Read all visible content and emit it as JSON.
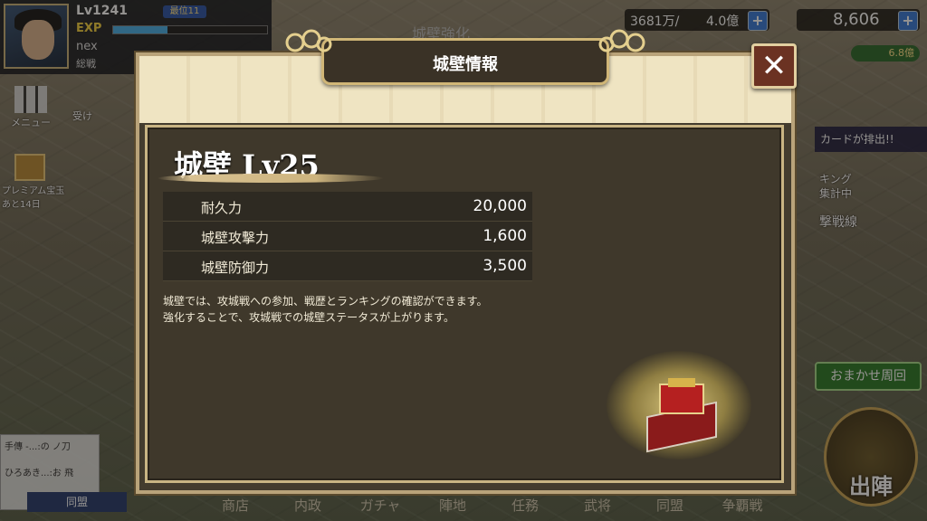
{
  "background": {
    "player": {
      "level": "Lv1241",
      "rank_badge": "最位11",
      "exp_label": "EXP",
      "exp_fill_pct": 35,
      "name": "nex",
      "power_label": "総戦"
    },
    "resource_1": {
      "value": "3681万/",
      "max": "4.0億"
    },
    "resource_2": {
      "value": "8,606"
    },
    "resource_sub": "6.8億",
    "background_title": "城壁強化",
    "menu_label": "メニュー",
    "receive_label": "受け",
    "premium_label": "プレミアム宝玉",
    "premium_days": "あと14日",
    "right_promo": "カードが排出!!",
    "right_ranking_1": "キング",
    "right_ranking_2": "集計中",
    "right_event": "撃戦線",
    "omakase_button": "おまかせ周回",
    "deploy_button": "出陣",
    "chat_lines": [
      "手傳 -...:の ノ刀",
      "ひろあき...:お 飛"
    ],
    "alliance_button": "同盟",
    "bottom_tabs": [
      "商店",
      "内政",
      "ガチャ",
      "陣地",
      "任務",
      "武将",
      "同盟",
      "争覇戦"
    ]
  },
  "modal": {
    "title": "城壁情報",
    "close_icon": "close-icon",
    "heading": "城壁 Lv25",
    "stats": [
      {
        "label": "耐久力",
        "value": "20,000"
      },
      {
        "label": "城壁攻撃力",
        "value": "1,600"
      },
      {
        "label": "城壁防御力",
        "value": "3,500"
      }
    ],
    "description": [
      "城壁では、攻城戦への参加、戦歴とランキングの確認ができます。",
      "強化することで、攻城戦での城壁ステータスが上がります。"
    ],
    "emblem_icon": "castle-wall-building-icon"
  }
}
